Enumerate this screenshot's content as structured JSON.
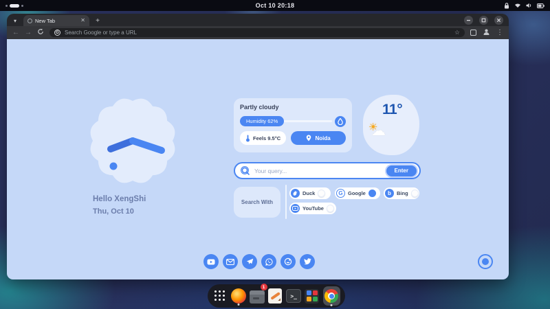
{
  "topbar": {
    "clock": "Oct 10 20:18"
  },
  "browser": {
    "tab_title": "New Tab",
    "omnibox_placeholder": "Search Google or type a URL"
  },
  "page": {
    "greeting": "Hello XengShi",
    "date": "Thu, Oct 10",
    "weather": {
      "condition": "Partly cloudy",
      "humidity": "Humidity 62%",
      "feels": "Feels 9.5°C",
      "city": "Noida",
      "temperature": "11°"
    },
    "search": {
      "placeholder": "Your query...",
      "enter": "Enter"
    },
    "search_with": {
      "label": "Search With",
      "engines": [
        {
          "label": "Duck",
          "selected": false
        },
        {
          "label": "Google",
          "selected": true
        },
        {
          "label": "Bing",
          "selected": false
        },
        {
          "label": "YouTube",
          "selected": false
        }
      ]
    },
    "socials": [
      {
        "name": "youtube"
      },
      {
        "name": "mail"
      },
      {
        "name": "telegram"
      },
      {
        "name": "whatsapp"
      },
      {
        "name": "instagram"
      },
      {
        "name": "twitter"
      }
    ]
  },
  "dock": {
    "badge": "1"
  },
  "glyphs": {
    "back": "←",
    "forward": "→",
    "star": "☆",
    "menu": "⋮",
    "google_g": "G",
    "bing_b": "b",
    "terminal_prompt": ">_",
    "sun": "☀",
    "cloud": "☁",
    "tab_chevron": "▾",
    "new_tab_plus": "+",
    "tab_close": "✕"
  },
  "colors": {
    "accent": "#4a86f2",
    "accent_dark": "#3e6fdc",
    "page_bg": "#c5d8f8",
    "card_bg": "#dde8fb",
    "temp_text": "#1d55b0"
  }
}
